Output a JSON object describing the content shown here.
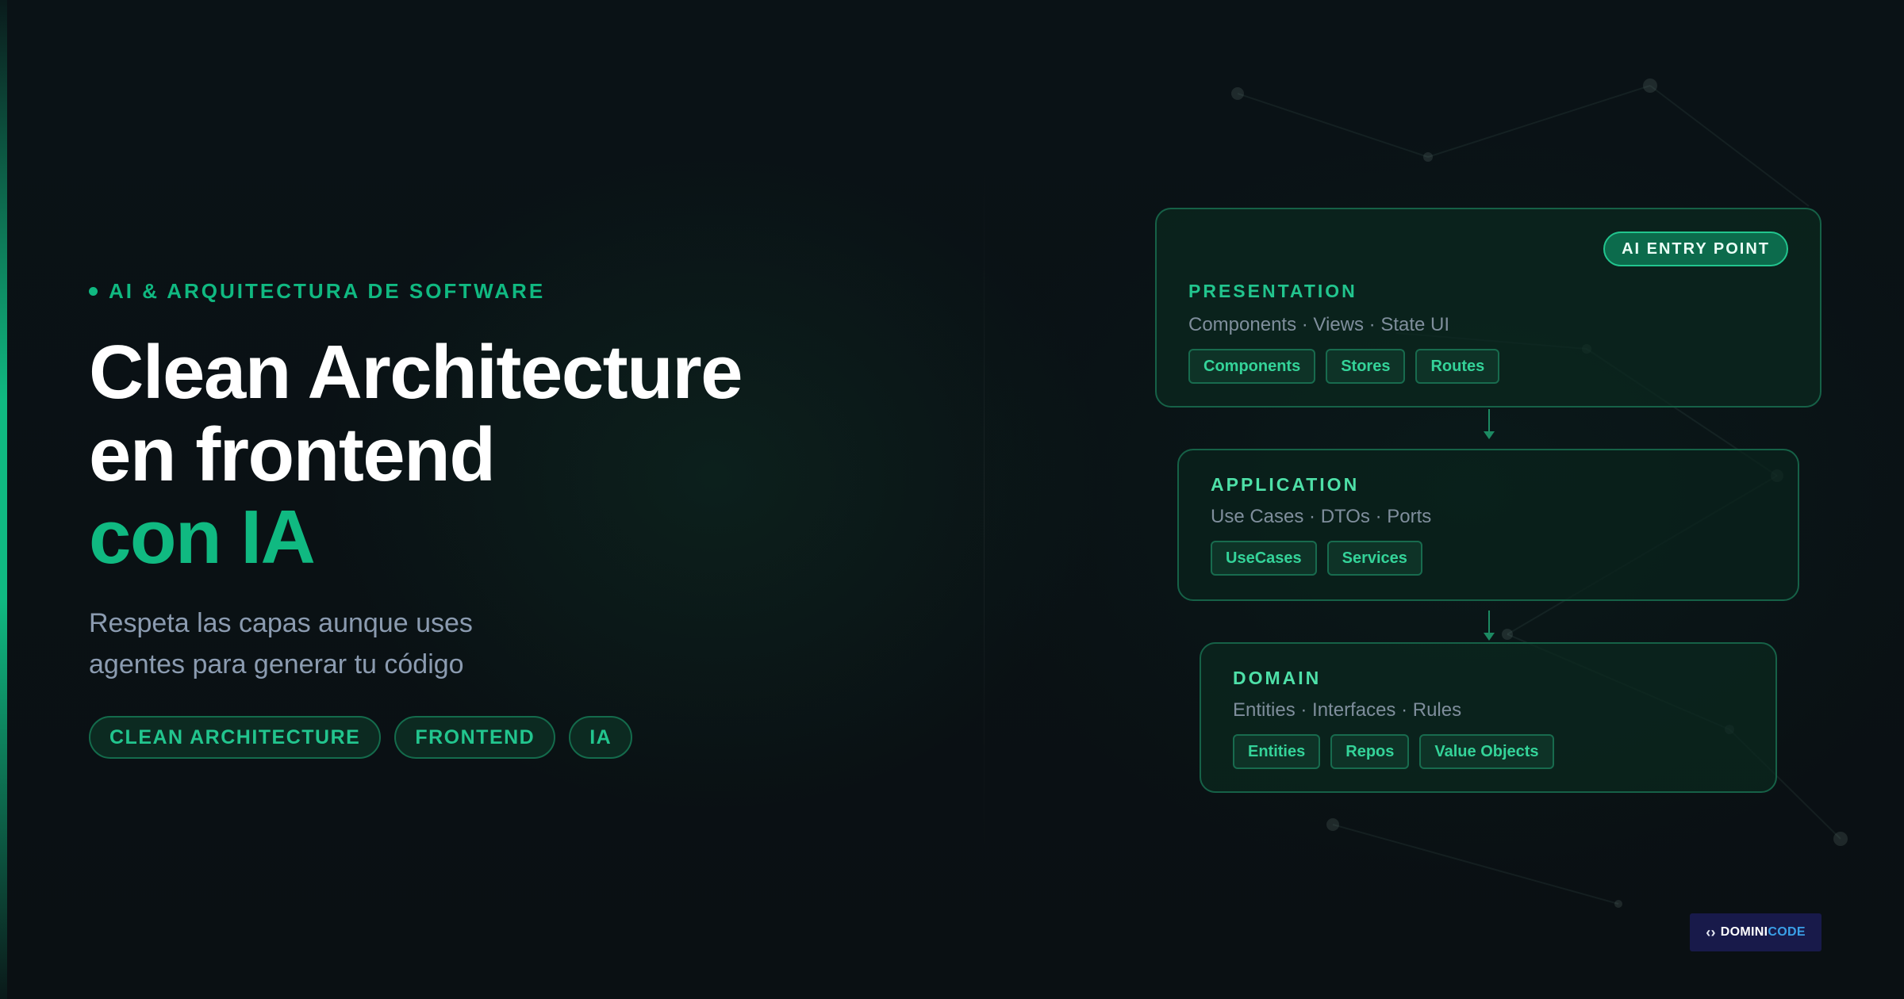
{
  "eyebrow": "AI & ARQUITECTURA DE SOFTWARE",
  "title": {
    "line1": "Clean Architecture",
    "line2": "en frontend",
    "line3": "con IA"
  },
  "subtitle": {
    "line1": "Respeta las capas aunque uses",
    "line2": "agentes para generar tu código"
  },
  "tags": [
    "CLEAN ARCHITECTURE",
    "FRONTEND",
    "IA"
  ],
  "layers": {
    "presentation": {
      "title": "PRESENTATION",
      "subtitle": "Components · Views · State UI",
      "chips": [
        "Components",
        "Stores",
        "Routes"
      ],
      "badge": "AI ENTRY POINT"
    },
    "application": {
      "title": "APPLICATION",
      "subtitle": "Use Cases · DTOs · Ports",
      "chips": [
        "UseCases",
        "Services"
      ]
    },
    "domain": {
      "title": "DOMAIN",
      "subtitle": "Entities · Interfaces · Rules",
      "chips": [
        "Entities",
        "Repos",
        "Value Objects"
      ]
    }
  },
  "brand": {
    "mark": "‹›",
    "name_part1": "DOMINI",
    "name_part2": "CODE"
  },
  "colors": {
    "accent": "#10b981",
    "background": "#0a1014",
    "card_border": "#166147",
    "brand_blue": "#3aa0e8"
  },
  "icons": [
    "eyebrow-dot-icon",
    "arrow-down-icon",
    "brand-code-icon"
  ]
}
